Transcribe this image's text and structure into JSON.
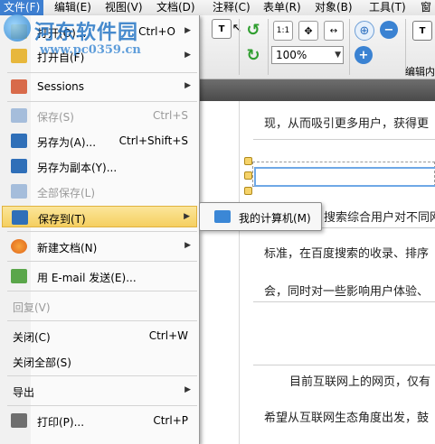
{
  "menubar": {
    "items": [
      "文件(F)",
      "编辑(E)",
      "视图(V)",
      "文档(D)",
      "注释(C)",
      "表单(R)",
      "对象(B)",
      "工具(T)",
      "窗"
    ]
  },
  "watermark": {
    "title": "河东软件园",
    "url": "www.pc0359.cn"
  },
  "file_menu": {
    "items": [
      {
        "label": "打开(O)...",
        "shortcut": "Ctrl+O"
      },
      {
        "label": "打开自(F)"
      },
      {
        "label": "Sessions"
      },
      {
        "label": "保存(S)",
        "shortcut": "Ctrl+S"
      },
      {
        "label": "另存为(A)...",
        "shortcut": "Ctrl+Shift+S"
      },
      {
        "label": "另存为副本(Y)..."
      },
      {
        "label": "全部保存(L)"
      },
      {
        "label": "保存到(T)"
      },
      {
        "label": "新建文档(N)"
      },
      {
        "label": "用 E-mail 发送(E)..."
      },
      {
        "label": "回复(V)"
      },
      {
        "label": "关闭(C)",
        "shortcut": "Ctrl+W"
      },
      {
        "label": "关闭全部(S)"
      },
      {
        "label": "导出"
      },
      {
        "label": "打印(P)...",
        "shortcut": "Ctrl+P"
      }
    ]
  },
  "submenu": {
    "label": "我的计算机(M)"
  },
  "toolbar": {
    "zoom": "100%",
    "page_fit": "1:1",
    "edit_label": "编辑内"
  },
  "document": {
    "lines": [
      "现，从而吸引更多用户，获得更",
      "搜索综合用户对不同网",
      "标准，在百度搜索的收录、排序",
      "会，同时对一些影响用户体验、",
      "目前互联网上的网页，仅有",
      "希望从互联网生态角度出发，鼓"
    ]
  },
  "colors": {
    "accent": "#3d7fd1",
    "highlight": "#f5cf60"
  }
}
